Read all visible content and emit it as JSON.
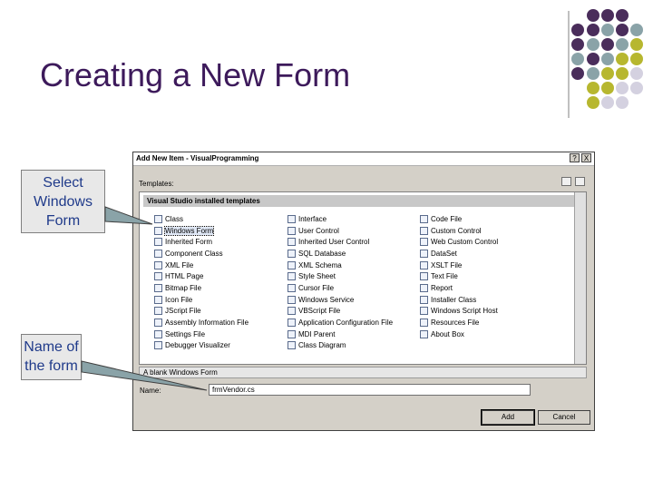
{
  "slide": {
    "title": "Creating a New Form"
  },
  "callouts": {
    "select_form": "Select Windows Form",
    "name_form": "Name of the form"
  },
  "colors": {
    "title": "#3d1a5b",
    "dot_purple": "#4a2d5b",
    "dot_teal": "#8aa3a8",
    "dot_olive": "#b7b72f",
    "dot_lavender": "#d4d1e0",
    "callout_text": "#1f3a8a"
  },
  "dialog": {
    "title": "Add New Item - VisualProgramming",
    "help_btn": "?",
    "close_btn": "X",
    "templates_label": "Templates:",
    "group_header": "Visual Studio installed templates",
    "columns": [
      [
        {
          "label": "Class",
          "icon": "class-icon"
        },
        {
          "label": "Windows Form",
          "icon": "form-icon",
          "selected": true
        },
        {
          "label": "Inherited Form",
          "icon": "form-icon"
        },
        {
          "label": "Component Class",
          "icon": "component-icon"
        },
        {
          "label": "XML File",
          "icon": "xml-icon"
        },
        {
          "label": "HTML Page",
          "icon": "html-icon"
        },
        {
          "label": "Bitmap File",
          "icon": "bitmap-icon"
        },
        {
          "label": "Icon File",
          "icon": "icon-file-icon"
        },
        {
          "label": "JScript File",
          "icon": "script-icon"
        },
        {
          "label": "Assembly Information File",
          "icon": "assembly-icon"
        },
        {
          "label": "Settings File",
          "icon": "settings-icon"
        },
        {
          "label": "Debugger Visualizer",
          "icon": "debugger-icon"
        }
      ],
      [
        {
          "label": "Interface",
          "icon": "interface-icon"
        },
        {
          "label": "User Control",
          "icon": "control-icon"
        },
        {
          "label": "Inherited User Control",
          "icon": "control-icon"
        },
        {
          "label": "SQL Database",
          "icon": "database-icon"
        },
        {
          "label": "XML Schema",
          "icon": "schema-icon"
        },
        {
          "label": "Style Sheet",
          "icon": "stylesheet-icon"
        },
        {
          "label": "Cursor File",
          "icon": "cursor-icon"
        },
        {
          "label": "Windows Service",
          "icon": "service-icon"
        },
        {
          "label": "VBScript File",
          "icon": "script-icon"
        },
        {
          "label": "Application Configuration File",
          "icon": "config-icon"
        },
        {
          "label": "MDI Parent",
          "icon": "form-icon"
        },
        {
          "label": "Class Diagram",
          "icon": "diagram-icon"
        }
      ],
      [
        {
          "label": "Code File",
          "icon": "code-icon"
        },
        {
          "label": "Custom Control",
          "icon": "control-icon"
        },
        {
          "label": "Web Custom Control",
          "icon": "control-icon"
        },
        {
          "label": "DataSet",
          "icon": "dataset-icon"
        },
        {
          "label": "XSLT File",
          "icon": "xslt-icon"
        },
        {
          "label": "Text File",
          "icon": "text-icon"
        },
        {
          "label": "Report",
          "icon": "report-icon"
        },
        {
          "label": "Installer Class",
          "icon": "installer-icon"
        },
        {
          "label": "Windows Script Host",
          "icon": "script-icon"
        },
        {
          "label": "Resources File",
          "icon": "resources-icon"
        },
        {
          "label": "About Box",
          "icon": "form-icon"
        }
      ]
    ],
    "description": "A blank Windows Form",
    "name_label": "Name:",
    "name_value": "frmVendor.cs",
    "add_button": "Add",
    "cancel_button": "Cancel"
  }
}
